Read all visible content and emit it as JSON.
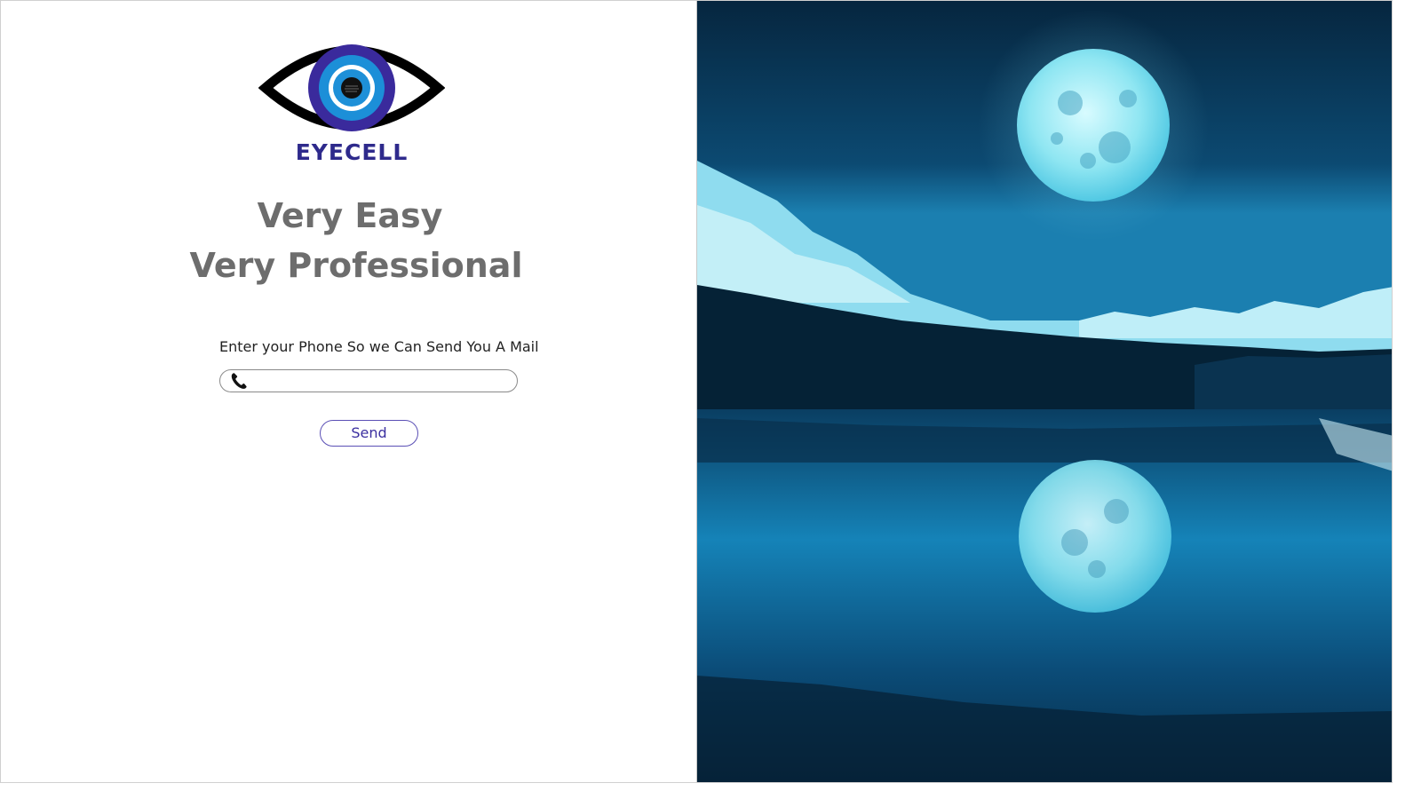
{
  "brand": {
    "name": "EYECELL",
    "color": "#2e2a8c"
  },
  "headline": {
    "line1": "Very Easy",
    "line2": "Very Professional"
  },
  "form": {
    "prompt": "Enter your Phone So we Can Send You A Mail",
    "phone_value": "",
    "phone_placeholder": "",
    "send_label": "Send"
  },
  "icons": {
    "phone": "phone-icon",
    "logo": "eye-logo-icon"
  },
  "colors": {
    "headline": "#6d6d6d",
    "button_text": "#3b2fa0",
    "night_sky": "#0b3a5e",
    "moon": "#8fe6f2"
  }
}
